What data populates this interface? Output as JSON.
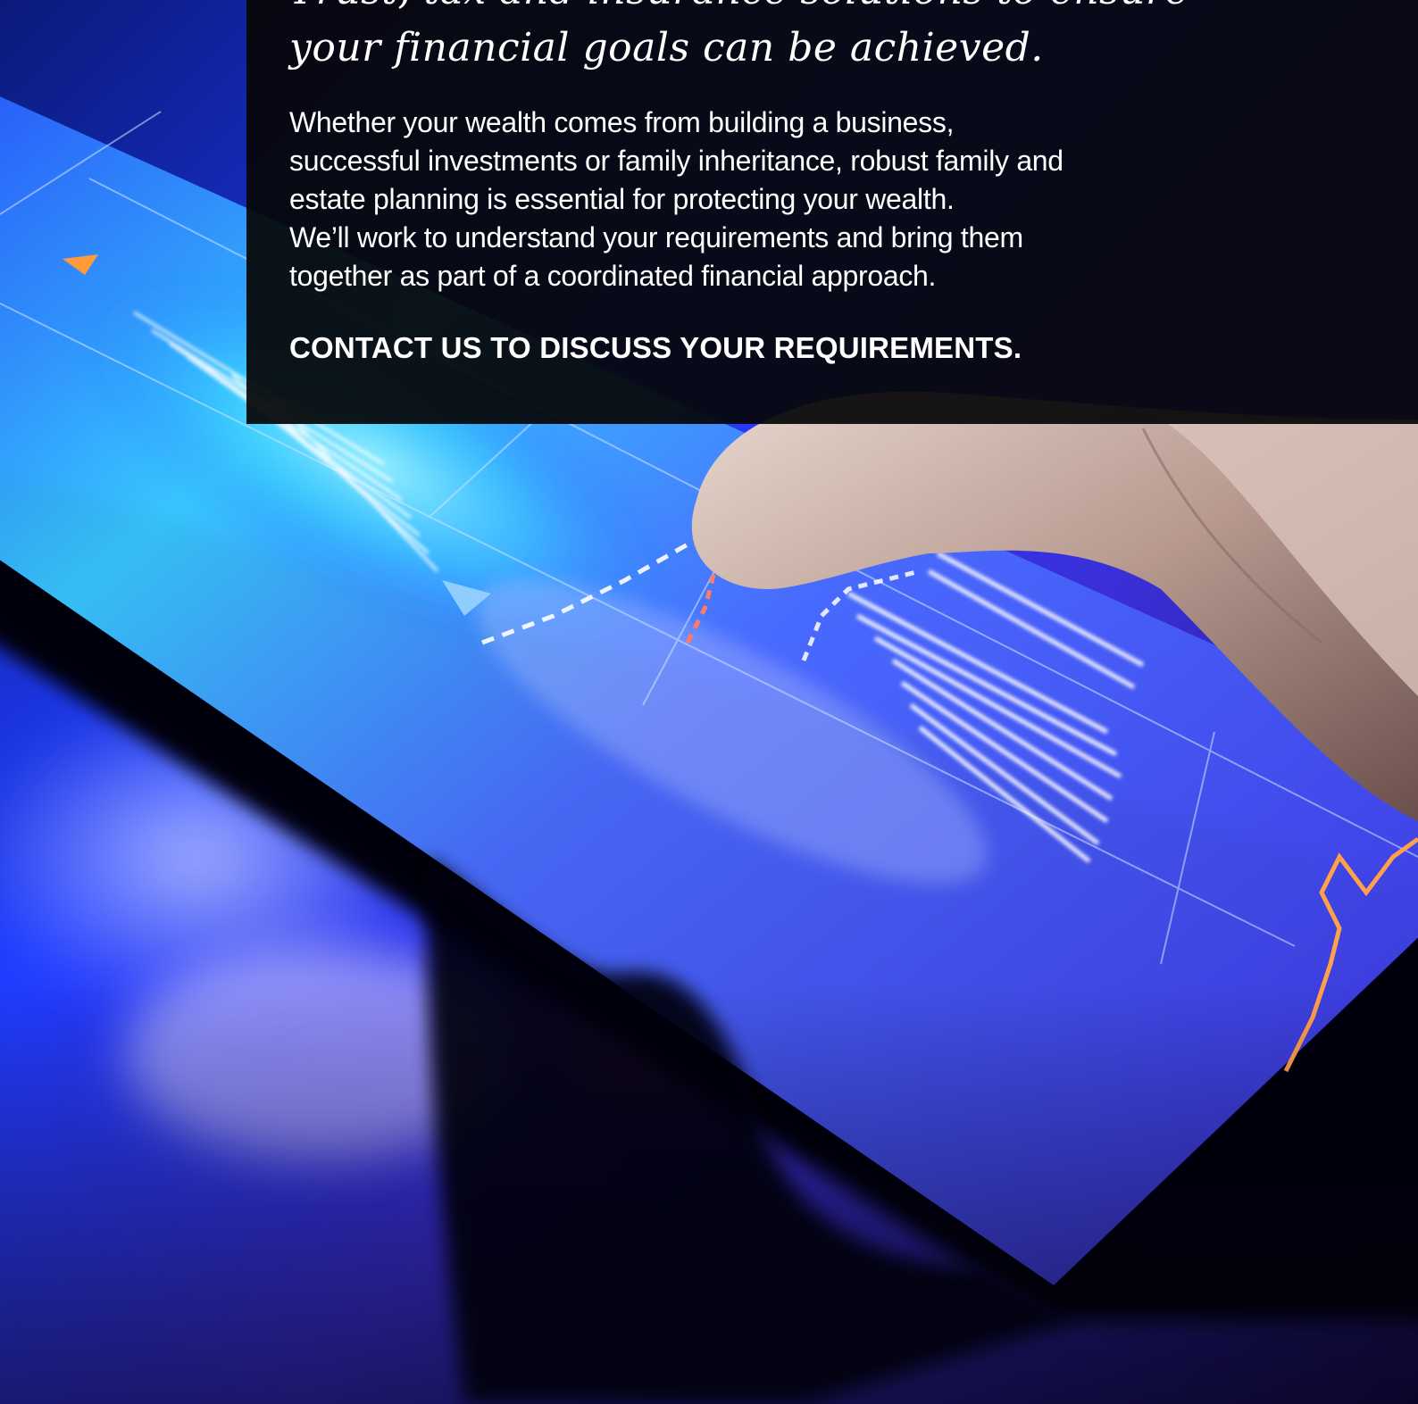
{
  "hero": {
    "headline_lines": [
      "Trust, tax and insurance solutions to ensure",
      "your financial goals can be achieved."
    ],
    "body_lines": [
      "Whether your wealth comes from building a business,",
      "successful investments or family inheritance, robust family and",
      "estate planning is essential for protecting your wealth.",
      "We’ll work to understand your requirements and bring them",
      "together as part of a coordinated financial approach."
    ],
    "cta_label": "CONTACT US TO DISCUSS YOUR REQUIREMENTS."
  },
  "colors": {
    "panel_background": "#060608",
    "text": "#ffffff",
    "screen_blue": "#2a4bff",
    "accent_orange": "#ff9a3c",
    "accent_pink": "#ff3fa8"
  }
}
